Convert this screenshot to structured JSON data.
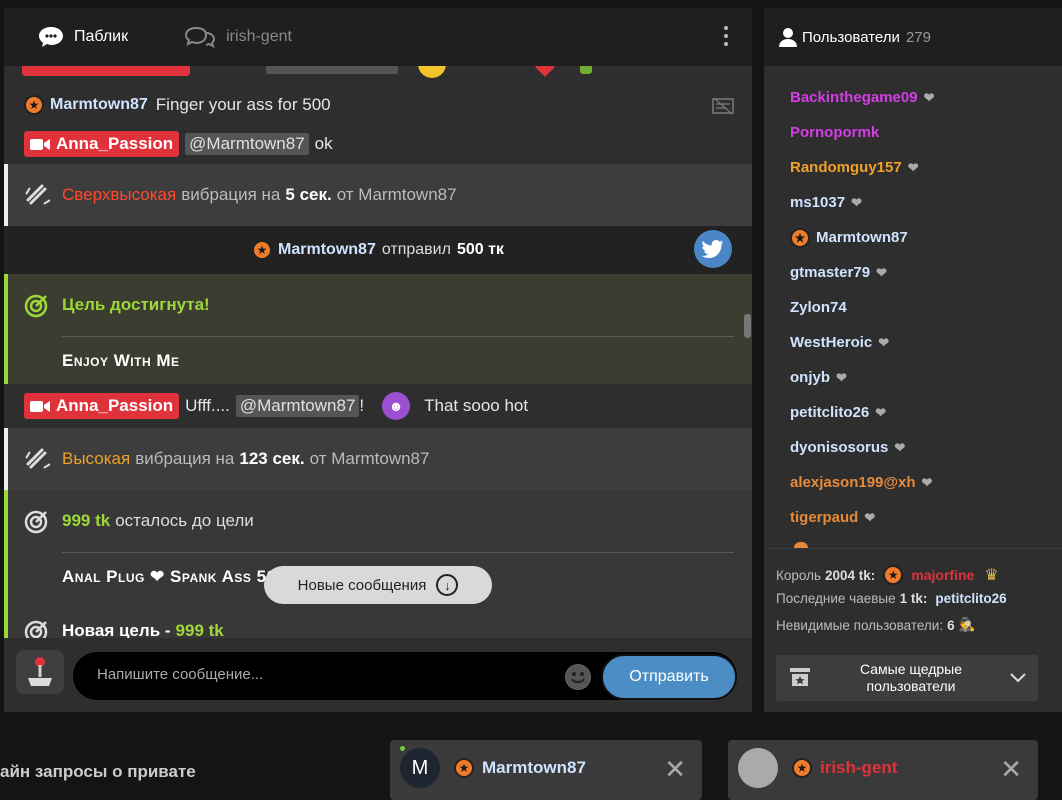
{
  "tabs": {
    "public": "Паблик",
    "private": "irish-gent"
  },
  "messages": {
    "m1": {
      "user": "Marmtown87",
      "text": "Finger your ass for 500"
    },
    "m2": {
      "user": "Anna_Passion",
      "mention": "@Marmtown87",
      "text": "ok"
    },
    "m3": {
      "level": "Сверхвысокая",
      "mid": "вибрация на",
      "dur": "5 сек.",
      "from": "от Marmtown87"
    },
    "m4": {
      "user": "Marmtown87",
      "action": "отправил",
      "amount": "500 тк"
    },
    "m5": {
      "title": "Цель достигнута!",
      "goal": "Enjoy With Me"
    },
    "m6": {
      "user": "Anna_Passion",
      "pre": "Ufff....",
      "mention": "@Marmtown87",
      "post": "!",
      "text": "That sooo hot"
    },
    "m7": {
      "level": "Высокая",
      "mid": "вибрация на",
      "dur": "123 сек.",
      "from": "от Marmtown87"
    },
    "m8": {
      "amount": "999 tk",
      "text": "осталось до цели",
      "goal": "Anal Plug ❤ Spank Ass 50X"
    },
    "m9": {
      "title": "Новая цель -",
      "amount": "999 tk"
    }
  },
  "new_messages": "Новые сообщения",
  "composer": {
    "placeholder": "Напишите сообщение...",
    "send": "Отправить"
  },
  "users": {
    "title": "Пользователи",
    "count": "279",
    "list": [
      {
        "name": "Backinthegame09",
        "color": "#d63de6",
        "heart": true
      },
      {
        "name": "Pornopormk",
        "color": "#d63de6",
        "heart": false
      },
      {
        "name": "Randomguy157",
        "color": "#f0a12a",
        "heart": true
      },
      {
        "name": "ms1037",
        "color": "#cfe3ff",
        "heart": true
      },
      {
        "name": "Marmtown87",
        "color": "#cfe3ff",
        "heart": false,
        "star": true
      },
      {
        "name": "gtmaster79",
        "color": "#cfe3ff",
        "heart": true
      },
      {
        "name": "Zylon74",
        "color": "#cfe3ff",
        "heart": false
      },
      {
        "name": "WestHeroic",
        "color": "#cfe3ff",
        "heart": true
      },
      {
        "name": "onjyb",
        "color": "#cfe3ff",
        "heart": true
      },
      {
        "name": "petitclito26",
        "color": "#cfe3ff",
        "heart": true
      },
      {
        "name": "dyonisosorus",
        "color": "#cfe3ff",
        "heart": true
      },
      {
        "name": "alexjason199@xh",
        "color": "#e8893a",
        "heart": true
      },
      {
        "name": "tigerpaud",
        "color": "#e8893a",
        "heart": true
      }
    ],
    "king_label": "Король",
    "king_amount": "2004 tk:",
    "king_name": "majorfine",
    "last_tip_label": "Последние чаевые",
    "last_tip_amount": "1 tk:",
    "last_tip_name": "petitclito26",
    "invisible_label": "Невидимые пользователи:",
    "invisible_count": "6",
    "top_button": "Самые щедрые пользователи"
  },
  "bottom_text": "айн запросы о привате",
  "pm_windows": [
    {
      "avatar": "M",
      "name": "Marmtown87",
      "color": "#cfe3ff"
    },
    {
      "avatar": "",
      "name": "irish-gent",
      "color": "#e0323b"
    }
  ]
}
